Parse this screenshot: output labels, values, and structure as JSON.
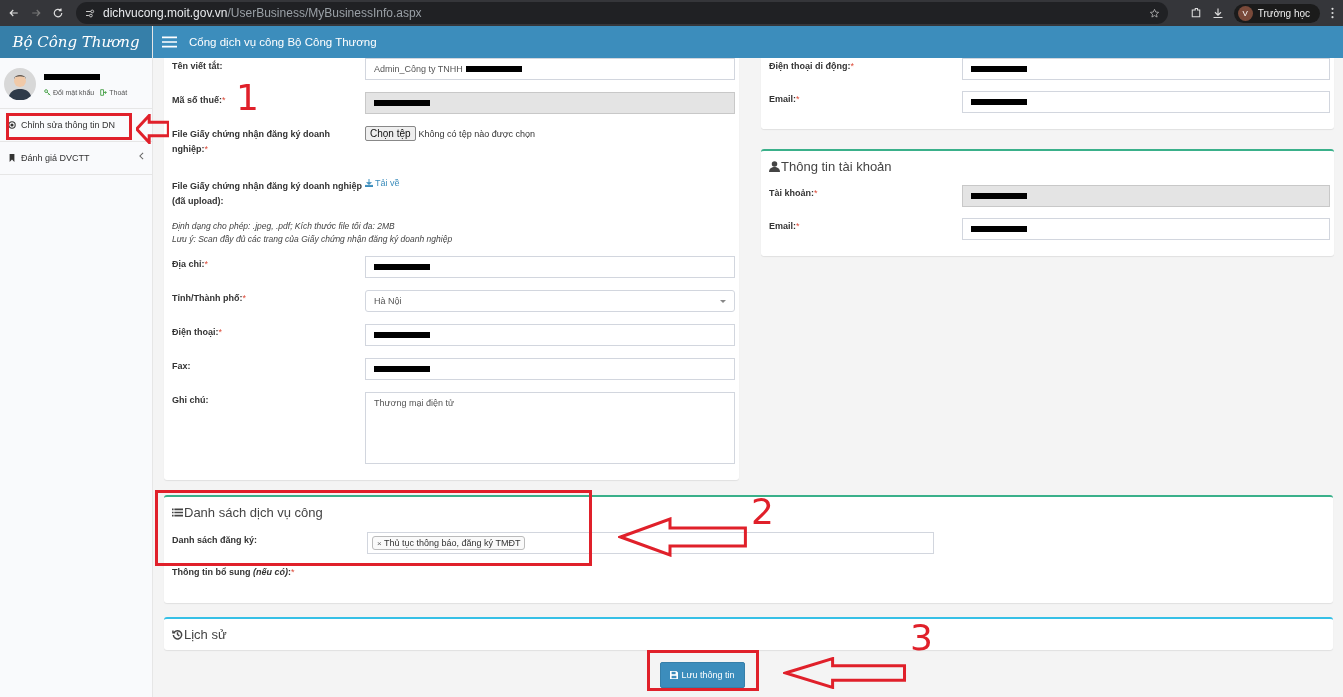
{
  "browser": {
    "url_domain": "dichvucong.moit.gov.vn",
    "url_path": "/UserBusiness/MyBusinessInfo.aspx",
    "profile_initial": "V",
    "profile_name": "Trường học"
  },
  "header": {
    "logo": "Bộ Công Thương",
    "title": "Cổng dịch vụ công Bộ Công Thương"
  },
  "sidebar": {
    "user": {
      "name_redacted": true,
      "links": [
        "Đổi mật khẩu",
        "Thoát"
      ]
    },
    "items": [
      {
        "label": "Chỉnh sửa thông tin DN",
        "kind": "link"
      },
      {
        "label": "Đánh giá DVCTT",
        "kind": "expandable"
      }
    ]
  },
  "business_form": {
    "fields": [
      {
        "kind": "text",
        "label": "Tên viết tắt:",
        "value": "Admin_Công ty TNHH",
        "redacted": true,
        "disabled": false
      },
      {
        "kind": "text",
        "label": "Mã số thuế:",
        "mark": "*",
        "redacted": true,
        "disabled": true
      },
      {
        "kind": "file",
        "label": "File Giấy chứng nhận đăng ký doanh nghiệp:",
        "mark": "*",
        "button": "Chọn tệp",
        "status": "Không có tệp nào được chọn"
      },
      {
        "kind": "download",
        "label": "File Giấy chứng nhận đăng ký doanh nghiệp (đã upload):",
        "link": "Tải về"
      },
      {
        "kind": "note",
        "lines": [
          "Định dạng cho phép: .jpeg, .pdf; Kích thước file tối đa: 2MB",
          "Lưu ý: Scan đầy đủ các trang của Giấy chứng nhận đăng ký doanh nghiệp"
        ]
      },
      {
        "kind": "text",
        "label": "Địa chỉ:",
        "mark": "*",
        "redacted": true,
        "disabled": false
      },
      {
        "kind": "select",
        "label": "Tỉnh/Thành phố:",
        "mark": "*",
        "value": "Hà Nội"
      },
      {
        "kind": "text",
        "label": "Điện thoại:",
        "mark": "*",
        "redacted": true,
        "disabled": false
      },
      {
        "kind": "text",
        "label": "Fax:",
        "redacted": true,
        "disabled": false
      },
      {
        "kind": "textarea",
        "label": "Ghi chú:",
        "value": "Thương mại điện tử"
      }
    ]
  },
  "contact_form": {
    "fields": [
      {
        "kind": "text",
        "label": "Điện thoại di động:",
        "mark": "*",
        "redacted": true,
        "disabled": false
      },
      {
        "kind": "text",
        "label": "Email:",
        "mark": "*",
        "redacted": true,
        "disabled": false
      }
    ]
  },
  "account": {
    "title": "Thông tin tài khoản",
    "fields": [
      {
        "kind": "text",
        "label": "Tài khoản:",
        "mark": "*",
        "redacted": true,
        "disabled": true
      },
      {
        "kind": "text",
        "label": "Email:",
        "mark": "*",
        "redacted": true,
        "disabled": false
      }
    ]
  },
  "services": {
    "title": "Danh sách dịch vụ công",
    "list_label": "Danh sách đăng ký:",
    "tags": [
      {
        "remove": "×",
        "label": "Thủ tục thông báo, đăng ký TMĐT"
      }
    ],
    "extra_label": "Thông tin bổ sung *(nếu có)*:",
    "extra_mark": "*"
  },
  "history": {
    "title": "Lịch sử"
  },
  "save_button": "Lưu thông tin",
  "annotations": [
    {
      "number": "1"
    },
    {
      "number": "2"
    },
    {
      "number": "3"
    }
  ]
}
